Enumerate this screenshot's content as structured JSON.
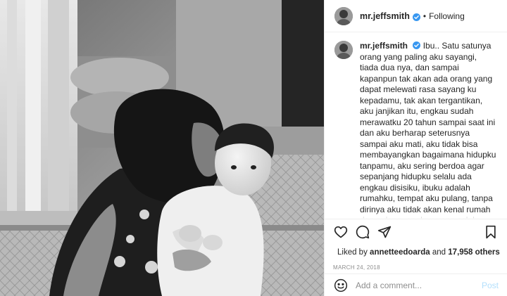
{
  "post": {
    "username": "mr.jeffsmith",
    "follow_state": "Following",
    "separator": "•",
    "photo_alt": "Black and white photo of a woman kissing a toddler on the cheek"
  },
  "caption": {
    "username": "mr.jeffsmith",
    "text": "Ibu.. Satu satunya orang yang paling aku sayangi, tiada dua nya, dan sampai kapanpun tak akan ada orang yang dapat melewati rasa sayang ku kepadamu, tak akan tergantikan, aku janjikan itu, engkau sudah merawatku 20 tahun sampai saat ini dan aku berharap seterusnya sampai aku mati, aku tidak bisa membayangkan bagaimana hidupku tanpamu, aku sering berdoa agar sepanjang hidupku selalu ada engkau disisiku, ibuku adalah rumahku, tempat aku pulang, tanpa dirinya aku tidak akan kenal rumah dan pulang, engkau yang selalu menyayangi ku, disaat aku susah, sakit, sedih, senang, bahagia, dan tak pernah aku tidak bisa"
  },
  "likes": {
    "prefix": "Liked by",
    "user": "annetteedoarda",
    "joiner": "and",
    "others": "17,958 others"
  },
  "date": "MARCH 24, 2018",
  "comment": {
    "placeholder": "Add a comment...",
    "post_label": "Post"
  },
  "icons": {
    "like": "heart-icon",
    "comment": "comment-icon",
    "share": "share-icon",
    "save": "bookmark-icon",
    "emoji": "emoji-icon",
    "verified": "verified-badge-icon"
  },
  "colors": {
    "verified": "#3897f0",
    "post_button": "#b2dffc",
    "muted": "#8e8e8e",
    "text": "#262626"
  }
}
